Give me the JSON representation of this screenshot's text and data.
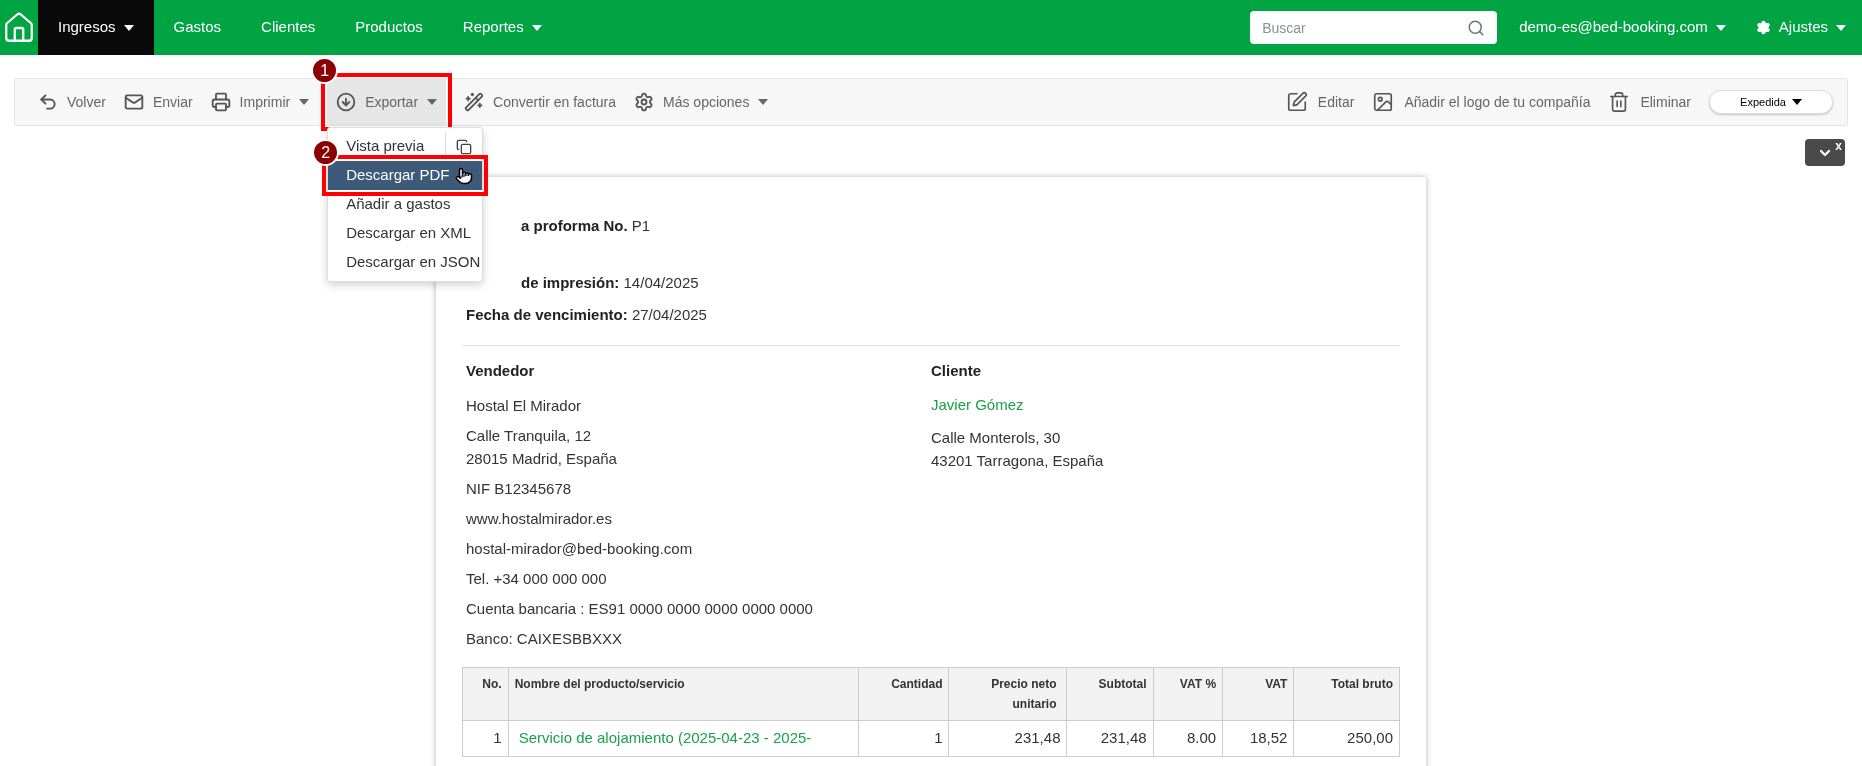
{
  "nav": {
    "items": [
      {
        "label": "Ingresos",
        "selected": true,
        "dropdown": true
      },
      {
        "label": "Gastos",
        "selected": false,
        "dropdown": false
      },
      {
        "label": "Clientes",
        "selected": false,
        "dropdown": false
      },
      {
        "label": "Productos",
        "selected": false,
        "dropdown": false
      },
      {
        "label": "Reportes",
        "selected": false,
        "dropdown": true
      }
    ],
    "search": {
      "placeholder": "Buscar"
    },
    "user": "demo-es@bed-booking.com",
    "settings": "Ajustes"
  },
  "toolbar": {
    "left": [
      {
        "label": "Volver",
        "dropdown": false,
        "selected": false
      },
      {
        "label": "Enviar",
        "dropdown": false,
        "selected": false
      },
      {
        "label": "Imprimir",
        "dropdown": true,
        "selected": false
      },
      {
        "label": "Exportar",
        "dropdown": true,
        "selected": true,
        "callout": "1"
      },
      {
        "label": "Convertir en factura",
        "dropdown": false,
        "selected": false
      },
      {
        "label": "Más opciones",
        "dropdown": true,
        "selected": false
      }
    ],
    "right": [
      {
        "label": "Editar"
      },
      {
        "label": "Añadir el logo de tu compañía"
      },
      {
        "label": "Eliminar"
      }
    ],
    "status": "Expedida"
  },
  "export_menu": [
    {
      "label": "Vista previa",
      "selected": false,
      "side_icon": true
    },
    {
      "label": "Descargar PDF",
      "selected": true,
      "callout": "2"
    },
    {
      "label": "Añadir a gastos",
      "selected": false
    },
    {
      "label": "Descargar en XML",
      "selected": false
    },
    {
      "label": "Descargar en JSON",
      "selected": false
    }
  ],
  "panel_toggle": {
    "close": "x"
  },
  "document": {
    "header_lines": [
      {
        "label": "a proforma No.",
        "value": "P1",
        "covered": true
      },
      {
        "label": "de impresión:",
        "value": "14/04/2025",
        "covered": true
      },
      {
        "label": "Fecha de vencimiento:",
        "value": "27/04/2025",
        "covered": false
      }
    ],
    "seller": {
      "heading": "Vendedor",
      "blocks": [
        [
          "Hostal El Mirador"
        ],
        [
          "Calle Tranquila, 12",
          "28015 Madrid, España"
        ],
        [
          "NIF B12345678"
        ],
        [
          "www.hostalmirador.es"
        ],
        [
          "hostal-mirador@bed-booking.com"
        ],
        [
          "Tel. +34 000 000 000"
        ],
        [
          "Cuenta bancaria : ES91 0000 0000 0000 0000 0000"
        ],
        [
          "Banco: CAIXESBBXXX"
        ]
      ]
    },
    "client": {
      "heading": "Cliente",
      "name": "Javier Gómez",
      "blocks": [
        [
          "Calle Monterols, 30",
          "43201 Tarragona, España"
        ]
      ]
    },
    "table": {
      "columns": [
        "No.",
        "Nombre del producto/servicio",
        "Cantidad",
        "Precio neto unitario",
        "Subtotal",
        "VAT %",
        "VAT",
        "Total bruto"
      ],
      "rows": [
        [
          "1",
          "Servicio de alojamiento (2025-04-23 - 2025-",
          "1",
          "231,48",
          "231,48",
          "8.00",
          "18,52",
          "250,00"
        ]
      ]
    }
  }
}
